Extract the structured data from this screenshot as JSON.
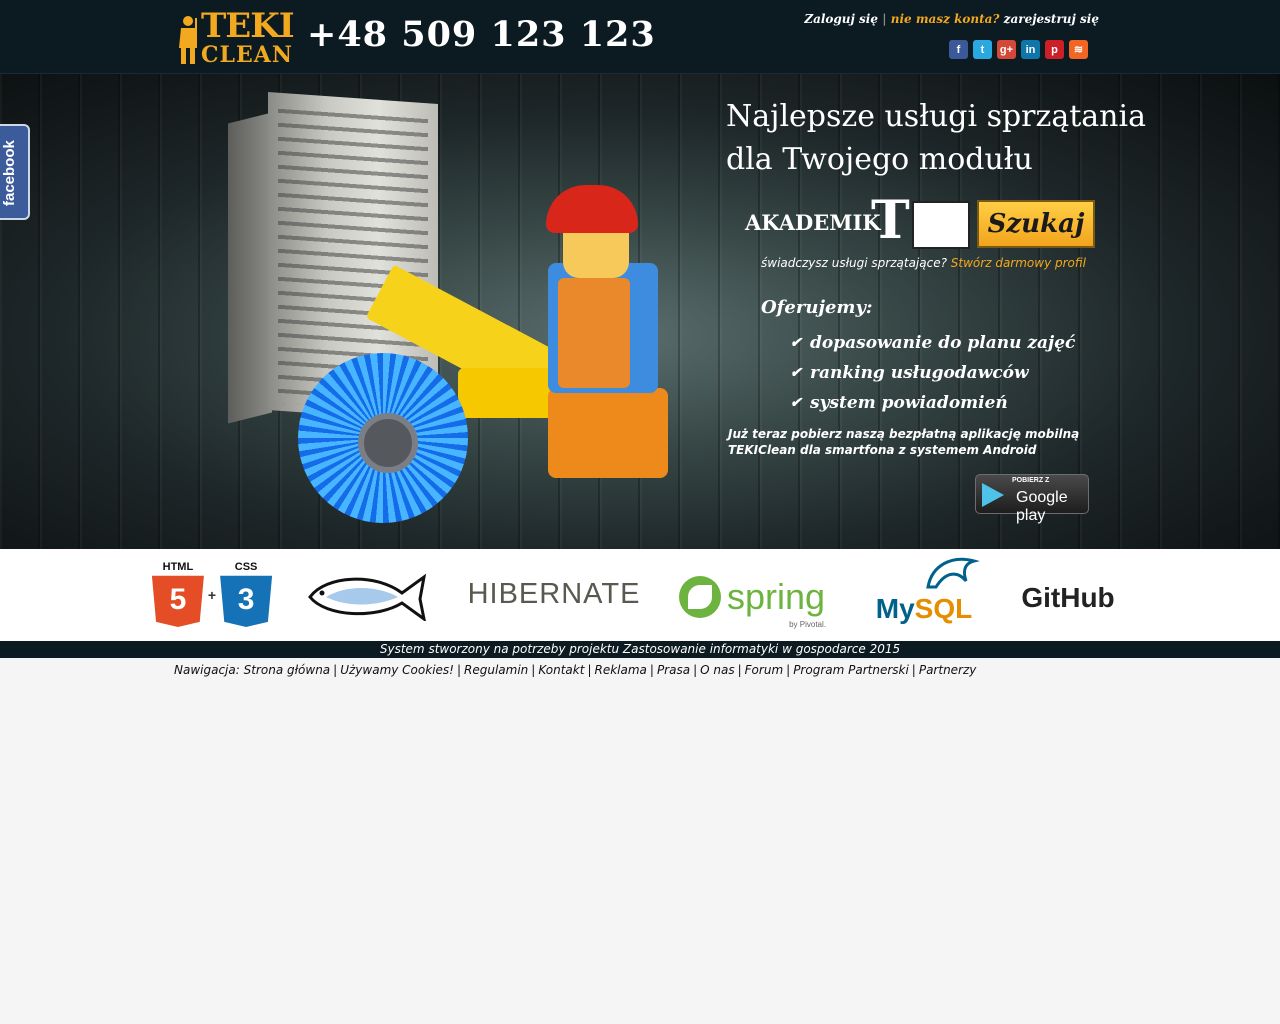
{
  "header": {
    "logo_top": "TEKI",
    "logo_bottom": "CLEAN",
    "phone": "+48 509 123 123",
    "login": "Zaloguj się",
    "separator": "|",
    "no_account": "nie masz konta?",
    "register": "zarejestruj się",
    "socials": [
      {
        "name": "facebook-icon",
        "glyph": "f",
        "color": "#3b5998"
      },
      {
        "name": "twitter-icon",
        "glyph": "t",
        "color": "#2aa9e0"
      },
      {
        "name": "google-plus-icon",
        "glyph": "g+",
        "color": "#d34836"
      },
      {
        "name": "linkedin-icon",
        "glyph": "in",
        "color": "#0e76a8"
      },
      {
        "name": "pinterest-icon",
        "glyph": "p",
        "color": "#cb2027"
      },
      {
        "name": "rss-icon",
        "glyph": "≋",
        "color": "#f26522"
      }
    ]
  },
  "facebook_tab": "facebook",
  "hero": {
    "tagline": "Najlepsze usługi sprzątania dla Twojego modułu",
    "akademik_label": "AKADEMIK",
    "akademik_letter": "T",
    "search_value": "",
    "search_button": "Szukaj",
    "provider_question": "świadczysz usługi sprzątające?",
    "provider_link": "Stwórz darmowy profil",
    "offer_title": "Oferujemy:",
    "offers": [
      "dopasowanie do planu zajęć",
      "ranking usługodawców",
      "system powiadomień"
    ],
    "app_text": "Już teraz pobierz naszą bezpłatną aplikację mobilną TEKIClean dla smartfona z systemem Android",
    "gplay_small": "POBIERZ Z",
    "gplay_big": "Google play"
  },
  "tech": {
    "html_cap": "HTML",
    "html_num": "5",
    "plus": "+",
    "css_cap": "CSS",
    "css_num": "3",
    "hibernate": "HIBERNATE",
    "spring": "spring",
    "pivotal": "by Pivotal.",
    "mysql_my": "My",
    "mysql_sql": "SQL",
    "github": "GitHub"
  },
  "footer": {
    "note": "System stworzony na potrzeby projektu Zastosowanie informatyki w gospodarce 2015",
    "nav_label": "Nawigacja:",
    "links": [
      "Strona główna",
      "Używamy Cookies!",
      "Regulamin",
      "Kontakt",
      "Reklama",
      "Prasa",
      "O nas",
      "Forum",
      "Program Partnerski",
      "Partnerzy"
    ]
  },
  "colors": {
    "header_bg": "#0c1a22",
    "accent": "#f3a91f",
    "page_bg": "#f5f5f5"
  }
}
